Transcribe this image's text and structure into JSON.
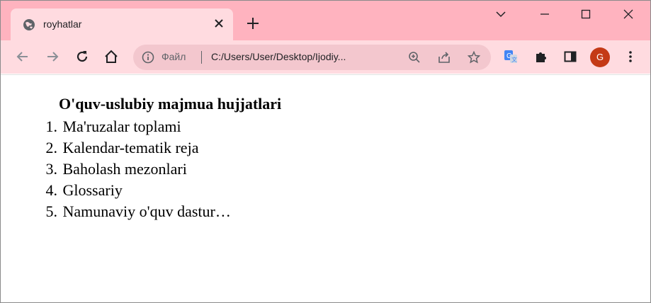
{
  "tab": {
    "title": "royhatlar"
  },
  "omnibox": {
    "scheme_label": "Файл",
    "url": "C:/Users/User/Desktop/Ijodiy..."
  },
  "profile": {
    "initial": "G"
  },
  "document": {
    "heading": "O'quv-uslubiy majmua hujjatlari",
    "items": [
      {
        "num": "1.",
        "text": "Ma'ruzalar toplami"
      },
      {
        "num": "2.",
        "text": "Kalendar-tematik reja"
      },
      {
        "num": "3.",
        "text": "Baholash mezonlari"
      },
      {
        "num": "4.",
        "text": "Glossariy"
      },
      {
        "num": "5.",
        "text": "Namunaviy o'quv dastur…"
      }
    ]
  },
  "icons": {
    "favicon": "globe-icon",
    "back": "back-arrow-icon",
    "forward": "forward-arrow-icon",
    "reload": "reload-icon",
    "home": "home-icon",
    "info": "info-icon",
    "zoom": "zoom-icon",
    "share": "share-icon",
    "bookmark": "star-icon",
    "translate": "translate-icon",
    "extensions": "puzzle-icon",
    "sidepanel": "side-panel-icon",
    "menu": "kebab-menu-icon"
  },
  "colors": {
    "tabstrip": "#ffb3bf",
    "toolbar": "#ffdbe0",
    "omnibox": "#f3c7ce",
    "avatar": "#c43a16"
  }
}
